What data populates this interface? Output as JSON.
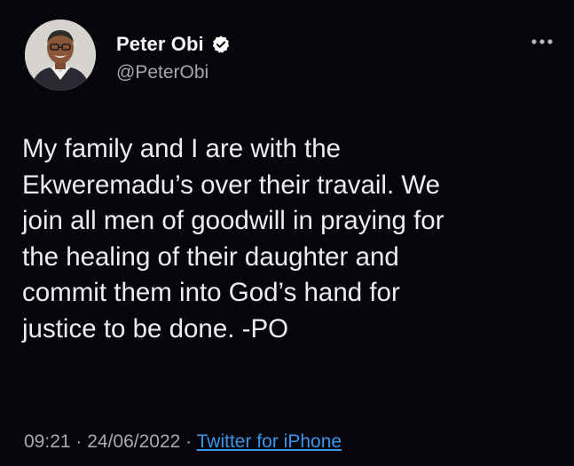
{
  "author": {
    "display_name": "Peter Obi",
    "handle": "@PeterObi",
    "verified": true
  },
  "tweet": {
    "lines": [
      "My family and I are with the",
      "Ekweremadu’s over their travail.  We",
      "join all men of goodwill in praying for",
      "the healing of their daughter and",
      "commit them into God’s hand for",
      "justice to be done. -PO"
    ],
    "time": "09:21",
    "separator": " · ",
    "date": "24/06/2022",
    "source": "Twitter for iPhone"
  },
  "icons": {
    "verified": "verified-badge-icon",
    "more": "more-options-icon"
  },
  "colors": {
    "background": "#06050b",
    "text": "#ececf1",
    "secondary_text": "#a7a7ae",
    "link": "#3b95e8",
    "verified_badge": "#ffffff"
  }
}
